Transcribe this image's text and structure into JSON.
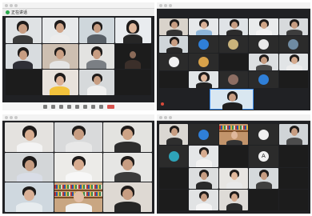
{
  "windows": [
    {
      "id": "q1",
      "title": "",
      "meeting_label": "正在讲话",
      "toolbar_items": [
        "mute",
        "video",
        "security",
        "participants",
        "chat",
        "share",
        "record",
        "reactions",
        "end"
      ]
    },
    {
      "id": "q2",
      "title": "",
      "right_label": "",
      "toolbar_items": []
    },
    {
      "id": "q3",
      "title": "",
      "toolbar_items": []
    },
    {
      "id": "q4",
      "title": "",
      "toolbar_items": []
    }
  ],
  "colors": {
    "window_bg": "#202124",
    "tile_dark": "#1c1c1c",
    "titlebar": "#f3f3f3",
    "toolbar": "#f5f5f5",
    "active_speaker": "#3a8df0",
    "end_button": "#d9534f"
  },
  "icons": {
    "window_controls": "traffic-light-icons",
    "meeting_info": "green-shield-icon",
    "avatar_blue": "profile-avatar-icon",
    "avatar_a": "letter-a-avatar-icon"
  },
  "avatars": {
    "letter_a": "A"
  }
}
